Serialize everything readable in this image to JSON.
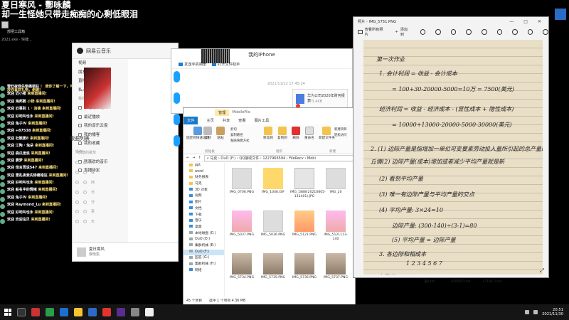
{
  "stream": {
    "title_line1": "夏日寒风 - 酆咏麟",
    "title_line2": "却一生怪她只带走痴痴的心剩低眼泪",
    "desktop_icon_label": "部把工具箱",
    "exe_line": "2021.exe · 快捷..."
  },
  "chat": [
    {
      "user": "雷旺夜我先惨痛错狂",
      "msg": "！ 我你了解一下，可以放你喜欢礼物，谢谢!"
    },
    {
      "user": "欢迎 迟小楼",
      "msg": "来到直播间!"
    },
    {
      "user": "欢迎 海邦鹅",
      "msg": "小杨 来到直播间!"
    },
    {
      "user": "欢迎 旧事别",
      "msg": "1 · 浊镇 来到直播间!"
    },
    {
      "user": "欢迎 好吧叫也永",
      "msg": "来到直播间!"
    },
    {
      "user": "欢迎 兔子IV",
      "msg": "来到直播间!"
    },
    {
      "user": "欢迎 +87538",
      "msg": "来到直播间!"
    },
    {
      "user": "欢迎 杜颖夏8",
      "msg": "来到直播间!"
    },
    {
      "user": "欢迎 江陶 · 兔朵",
      "msg": "来到直播间!"
    },
    {
      "user": "欢迎 森瓜迷浪",
      "msg": "来到直播间!"
    },
    {
      "user": "欢迎 晨梦",
      "msg": "来到直播间!"
    },
    {
      "user": "欢迎 借言再说547",
      "msg": "来到直播间!"
    },
    {
      "user": "欢迎 雷乱夜我先惨痛错狂",
      "msg": "来到直播间!"
    },
    {
      "user": "欢迎 好吧叫也永",
      "msg": "来到直播间!"
    },
    {
      "user": "欢迎 船名字的情绪",
      "msg": "来到直播间!"
    },
    {
      "user": "欢迎 兔子IV",
      "msg": "来到直播间!"
    },
    {
      "user": "欢迎 Raymond_Lu",
      "msg": "来到直播间!"
    },
    {
      "user": "欢迎 好吧叫也永",
      "msg": "来到直播间!"
    },
    {
      "user": "欢迎 欢迎宝贝",
      "msg": "来到直播间!"
    }
  ],
  "music": {
    "app_name": "网易云音乐",
    "sidebar": [
      {
        "label": "视频",
        "section": false
      },
      {
        "label": "朋友",
        "section": false
      },
      {
        "label": "直播",
        "section": false
      },
      {
        "label": "私人FM",
        "section": false
      },
      {
        "label": "我的音乐",
        "section": true
      },
      {
        "label": "本地与下载",
        "section": false
      },
      {
        "label": "最近播放",
        "section": false
      },
      {
        "label": "我的音乐云盘",
        "section": false
      },
      {
        "label": "我的播客",
        "section": false
      },
      {
        "label": "我的收藏",
        "section": false
      },
      {
        "label": "创建的歌单",
        "section": true
      },
      {
        "label": "我喜欢的音乐",
        "section": false
      },
      {
        "label": "直播待定",
        "section": false
      }
    ],
    "songlist_title": "歌曲列表",
    "col_action": "操作",
    "row_texts": [
      "红",
      "我",
      "西",
      "日",
      "守",
      "芙",
      "天"
    ],
    "user_name": "夏日寒风",
    "user_sub": "爆绝集"
  },
  "iphone": {
    "title": "我的iPhone",
    "send_file": "发送手机相册",
    "transfer": "打开文件助手",
    "timestamp": "2021/11/22 17:45:24",
    "file_name": "华为公司2020年财务报表",
    "file_size": "373.4KB"
  },
  "explorer": {
    "title_tab": "管理",
    "title_path": "MobileFile",
    "tabs": [
      "文件",
      "主页",
      "共享",
      "查看",
      "图片工具"
    ],
    "ribbon": {
      "pin": "固定到快速访问",
      "copy": "复制",
      "paste": "粘贴",
      "cut": "剪切",
      "copy_path": "复制路径",
      "paste_shortcut": "粘贴快捷方式",
      "move_to": "移动到",
      "copy_to": "复制到",
      "delete": "删除",
      "rename": "重命名",
      "new_folder": "新建文件夹",
      "new_item": "新建项目",
      "easy_access": "轻松访问",
      "sec_clipboard": "剪贴板",
      "sec_organize": "组织",
      "sec_new": "新建"
    },
    "address": "« 马克 › OuO (F:) › QQ接收文件 › 1227966594 › FileRecv › Mobi",
    "nav": [
      {
        "label": "ppt",
        "type": "folder"
      },
      {
        "label": "word",
        "type": "folder"
      },
      {
        "label": "财务报表",
        "type": "folder"
      },
      {
        "label": "马克",
        "type": "pc"
      },
      {
        "label": "3D 对象",
        "type": "blue"
      },
      {
        "label": "视频",
        "type": "blue"
      },
      {
        "label": "图片",
        "type": "blue"
      },
      {
        "label": "文档",
        "type": "blue"
      },
      {
        "label": "下载",
        "type": "blue"
      },
      {
        "label": "音乐",
        "type": "blue"
      },
      {
        "label": "桌面",
        "type": "blue"
      },
      {
        "label": "本地磁盘 (C:)",
        "type": "gray"
      },
      {
        "label": "OuO (D:)",
        "type": "gray"
      },
      {
        "label": "集群机械 (E:)",
        "type": "gray"
      },
      {
        "label": "OuO (F:)",
        "type": "gray",
        "selected": true
      },
      {
        "label": "固态 (G:)",
        "type": "gray"
      },
      {
        "label": "集群机械 (H:)",
        "type": "gray"
      },
      {
        "label": "网络",
        "type": "blue"
      }
    ],
    "files": [
      {
        "name": "IMG_0706.PNG",
        "thumb": "w"
      },
      {
        "name": "IMG_1046.GIF",
        "thumb": "y"
      },
      {
        "name": "IMG_1888(20210805-132401).JPG",
        "thumb": "d"
      },
      {
        "name": "IMG_20",
        "thumb": "w"
      },
      {
        "name": "IMG_5037.PNG",
        "thumb": "p"
      },
      {
        "name": "IMG_5036.PNG",
        "thumb": "w"
      },
      {
        "name": "IMG_5121.PNG",
        "thumb": "o"
      },
      {
        "name": "IMG_5121113-140",
        "thumb": "p"
      },
      {
        "name": "IMG_5734.PNG",
        "thumb": "g"
      },
      {
        "name": "IMG_5735.PNG",
        "thumb": "g"
      },
      {
        "name": "IMG_5736.PNG",
        "thumb": "g"
      },
      {
        "name": "IMG_5737.PNG",
        "thumb": "g"
      },
      {
        "name": "IMG_5739.PNG",
        "thumb": "g"
      },
      {
        "name": "IMG_5740.PNG",
        "thumb": "g"
      },
      {
        "name": "计算机工作(服务器).txt",
        "thumb": "d"
      },
      {
        "name": "文本 (2019-09-05 020657).txt",
        "thumb": "d"
      },
      {
        "name": "文本 (2021-11-02 171017).txt",
        "thumb": "d"
      }
    ],
    "status_count": "45 个项目",
    "status_selected": "选中 1 个项目 4.36 MB"
  },
  "photos": {
    "title": "照片 - IMG_5751.PNG",
    "toolbar": [
      "查看所有照片",
      "添加到"
    ],
    "controls": [
      "—",
      "□",
      "✕"
    ],
    "handwriting": [
      "第一次作业",
      "1.  会计利润 = 收益 - 会计成本",
      "= 100+30-20000-5000=10万  = 7500(美元)",
      "经济利润 = 收益 - 经济成本 - (显性成本 + 隐性成本)",
      "= 10000+13000-20000-5000-30000(美元)",
      "2. (1) 边际产量是指增加一单位可变要素劳动投入量所引起的总产量的增加",
      "丘情(2) 边际产量(成本)增加或者减少平均产量就是新",
      "(2) 看到平均产量",
      "(3) 唯一有边际产量与平均产量的交点",
      "(4) 平均产量: 3×24=10",
      "边际产量: (300-140)÷(3-1)=80",
      "(5) 平均产量 = 边际产量",
      "3. 各边际和相成本",
      "1    2    3    4    5    6    7",
      "产量总"
    ]
  },
  "taskbar": {
    "time": "20:51",
    "date": "2021/11/30"
  }
}
